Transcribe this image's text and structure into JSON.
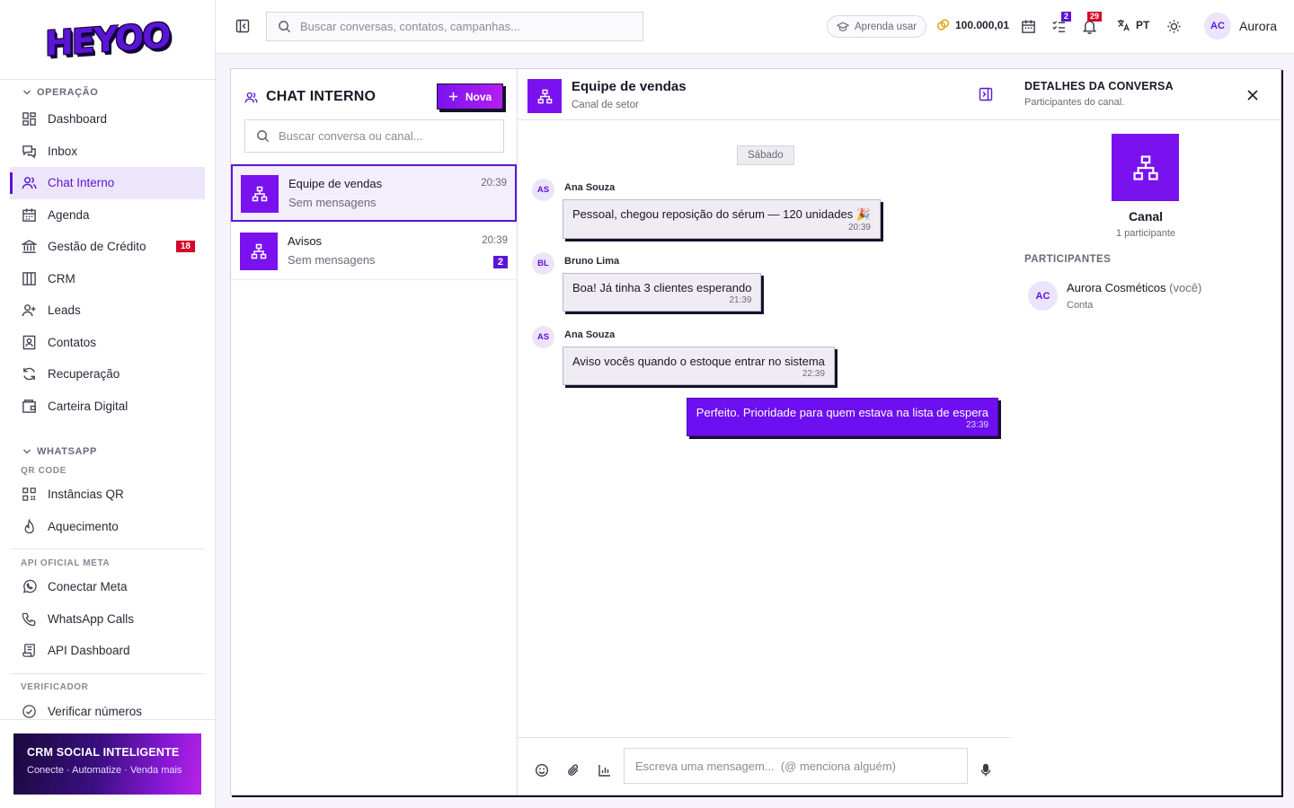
{
  "app": {
    "logo": "HEYOO"
  },
  "sidebar": {
    "sections": [
      {
        "title": "OPERAÇÃO"
      },
      {
        "title": "WHATSAPP"
      }
    ],
    "operacao_items": [
      {
        "label": "Dashboard"
      },
      {
        "label": "Inbox"
      },
      {
        "label": "Chat Interno"
      },
      {
        "label": "Agenda"
      },
      {
        "label": "Gestão de Crédito",
        "badge": "18"
      },
      {
        "label": "CRM"
      },
      {
        "label": "Leads"
      },
      {
        "label": "Contatos"
      },
      {
        "label": "Recuperação"
      },
      {
        "label": "Carteira Digital"
      }
    ],
    "whatsapp": {
      "qr_label": "QR CODE",
      "qr_items": [
        {
          "label": "Instâncias QR"
        },
        {
          "label": "Aquecimento"
        }
      ],
      "meta_label": "API OFICIAL META",
      "meta_items": [
        {
          "label": "Conectar Meta"
        },
        {
          "label": "WhatsApp Calls"
        },
        {
          "label": "API Dashboard"
        }
      ],
      "verif_label": "VERIFICADOR",
      "verif_items": [
        {
          "label": "Verificar números"
        }
      ]
    },
    "promo": {
      "title": "CRM SOCIAL INTELIGENTE",
      "subtitle": "Conecte · Automatize · Venda mais"
    }
  },
  "topbar": {
    "search_placeholder": "Buscar conversas, contatos, campanhas...",
    "learn_label": "Aprenda usar",
    "coins": "100.000,01",
    "tasks_badge": "2",
    "notif_badge": "29",
    "lang": "PT",
    "user_initials": "AC",
    "user_name": "Aurora"
  },
  "conversations": {
    "title": "CHAT INTERNO",
    "new_label": "Nova",
    "search_placeholder": "Buscar conversa ou canal...",
    "items": [
      {
        "name": "Equipe de vendas",
        "subtitle": "Sem mensagens",
        "time": "20:39"
      },
      {
        "name": "Avisos",
        "subtitle": "Sem mensagens",
        "time": "20:39",
        "unread": "2"
      }
    ]
  },
  "chat": {
    "title": "Equipe de vendas",
    "subtitle": "Canal de setor",
    "day": "Sábado",
    "messages": [
      {
        "initials": "AS",
        "author": "Ana Souza",
        "text": "Pessoal, chegou reposição do sérum — 120 unidades 🎉",
        "time": "20:39"
      },
      {
        "initials": "BL",
        "author": "Bruno Lima",
        "text": "Boa! Já tinha 3 clientes esperando",
        "time": "21:39"
      },
      {
        "initials": "AS",
        "author": "Ana Souza",
        "text": "Aviso vocês quando o estoque entrar no sistema",
        "time": "22:39"
      },
      {
        "text": "Perfeito. Prioridade para quem estava na lista de espera",
        "time": "23:39"
      }
    ],
    "composer_placeholder": "Escreva uma mensagem...  (@ menciona alguém)"
  },
  "details": {
    "title": "DETALHES DA CONVERSA",
    "subtitle": "Participantes do canal.",
    "channel_name": "Canal",
    "participant_count": "1 participante",
    "section": "PARTICIPANTES",
    "participants": [
      {
        "initials": "AC",
        "name": "Aurora Cosméticos",
        "you": "(você)",
        "role": "Conta"
      }
    ]
  },
  "colors": {
    "accent": "#5b15d6",
    "accent_bright": "#7a12f0",
    "badge_red": "#d3072b"
  }
}
